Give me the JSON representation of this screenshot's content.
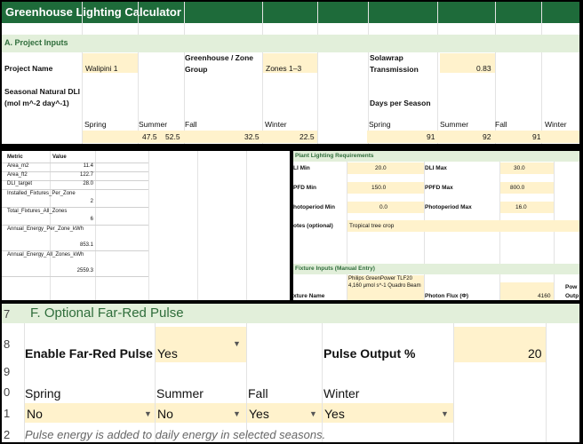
{
  "panel1": {
    "title": "Greenhouse Lighting Calculator",
    "section": "A. Project Inputs",
    "project_name_label": "Project Name",
    "project_name_value": "Walipini 1",
    "zone_group_label_1": "Greenhouse / Zone",
    "zone_group_label_2": "Group",
    "zone_group_value": "Zones 1–3",
    "solawrap_label_1": "Solawrap",
    "solawrap_label_2": "Transmission",
    "solawrap_value": "0.83",
    "dli_label_1": "Seasonal Natural DLI",
    "dli_label_2": "(mol m^-2 day^-1)",
    "days_label": "Days per Season",
    "dli_seasons": [
      "Spring",
      "Summer",
      "Fall",
      "Winter"
    ],
    "dli_values": [
      "47.5",
      "52.5",
      "32.5",
      "22.5"
    ],
    "days_seasons": [
      "Spring",
      "Summer",
      "Fall",
      "Winter"
    ],
    "days_values": [
      "91",
      "92",
      "91"
    ]
  },
  "panel2": {
    "header_metric": "Metric",
    "header_value": "Value",
    "rows": [
      {
        "k": "Area_m2",
        "v": "11.4"
      },
      {
        "k": "Area_ft2",
        "v": "122.7"
      },
      {
        "k": "DLI_target",
        "v": "28.0"
      },
      {
        "k": "Installed_Fixtures_Per_Zone",
        "v": "2"
      },
      {
        "k": "Total_Fixtures_All_Zones",
        "v": "6"
      },
      {
        "k": "Annual_Energy_Per_Zone_kWh",
        "v": "853.1"
      },
      {
        "k": "Annual_Energy_All_Zones_kWh",
        "v": "2559.3"
      }
    ]
  },
  "panel3": {
    "section1": "Plant Lighting Requirements",
    "dli_min_label": "LI Min",
    "dli_min_value": "20.0",
    "dli_max_label": "DLI Max",
    "dli_max_value": "30.0",
    "ppfd_min_label": "PFD Min",
    "ppfd_min_value": "150.0",
    "ppfd_max_label": "PPFD Max",
    "ppfd_max_value": "800.0",
    "photo_min_label": "hotoperiod Min",
    "photo_min_value": "0.0",
    "photo_max_label": "Photoperiod Max",
    "photo_max_value": "16.0",
    "notes_label": "otes (optional)",
    "notes_value": "Tropical tree crop",
    "section2": "Fixture Inputs (Manual Entry)",
    "fixture_name_label": "xture Name",
    "fixture_name_value": "Philips GreenPower TLF20 4,160 μmol s^-1 Quadro Beam",
    "photon_flux_label": "Photon Flux (Φ)",
    "photon_flux_value": "4160",
    "power_label_1": "Pow",
    "power_label_2": "Outp"
  },
  "panel4": {
    "row_numbers": [
      "7",
      "8",
      "9",
      "0",
      "1",
      "2"
    ],
    "section": "F. Optional Far-Red Pulse",
    "enable_label": "Enable Far-Red Pulse",
    "enable_value": "Yes",
    "pulse_label": "Pulse Output %",
    "pulse_value": "20",
    "seasons": [
      "Spring",
      "Summer",
      "Fall",
      "Winter"
    ],
    "season_values": [
      "No",
      "No",
      "Yes",
      "Yes"
    ],
    "note": "Pulse energy is added to daily energy in selected seasons."
  },
  "colors": {
    "title_bar": "#1e6b3a",
    "section_band": "#e2efda",
    "input_fill": "#fff2cc",
    "section_text": "#2f6d3b"
  }
}
